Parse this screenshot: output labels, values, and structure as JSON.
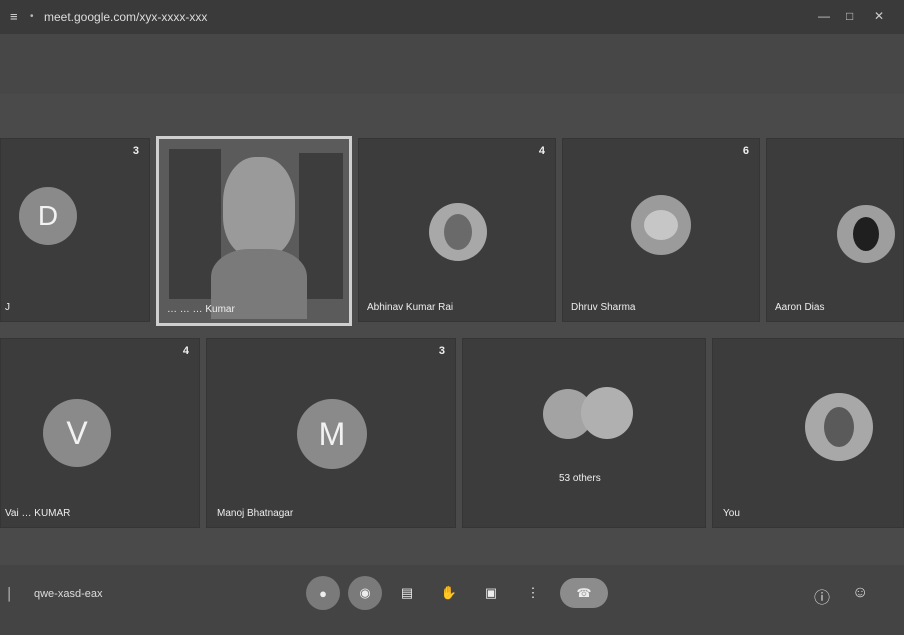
{
  "window": {
    "title": "meet.google.com/xyx-xxxx-xxx",
    "tab_marker": "•"
  },
  "tiles": {
    "row1": [
      {
        "initial": "D",
        "badge": "3",
        "name": "J"
      },
      {
        "name": "… … … Kumar"
      },
      {
        "badge": "4",
        "name": "Abhinav Kumar Rai"
      },
      {
        "badge": "6",
        "name": "Dhruv Sharma"
      },
      {
        "name": "Aaron Dias"
      }
    ],
    "row2": [
      {
        "initial": "V",
        "badge": "4",
        "name": "Vai … KUMAR"
      },
      {
        "initial": "M",
        "badge": "3",
        "name": "Manoj Bhatnagar"
      },
      {
        "name": "53 others"
      },
      {
        "name": "You"
      }
    ]
  },
  "bottom": {
    "meeting_code": "qwe-xasd-eax",
    "controls": [
      {
        "icon": "mic-icon",
        "glyph": "●"
      },
      {
        "icon": "camera-icon",
        "glyph": "◉"
      },
      {
        "icon": "captions-icon",
        "glyph": "▤"
      },
      {
        "icon": "raise-hand-icon",
        "glyph": "✋"
      },
      {
        "icon": "present-icon",
        "glyph": "▣"
      },
      {
        "icon": "more-options-icon",
        "glyph": "⋮"
      },
      {
        "icon": "end-call-icon",
        "glyph": "☎"
      }
    ],
    "right": [
      {
        "icon": "info-icon",
        "glyph": "ⓘ"
      },
      {
        "icon": "people-icon",
        "glyph": "☺"
      }
    ]
  }
}
